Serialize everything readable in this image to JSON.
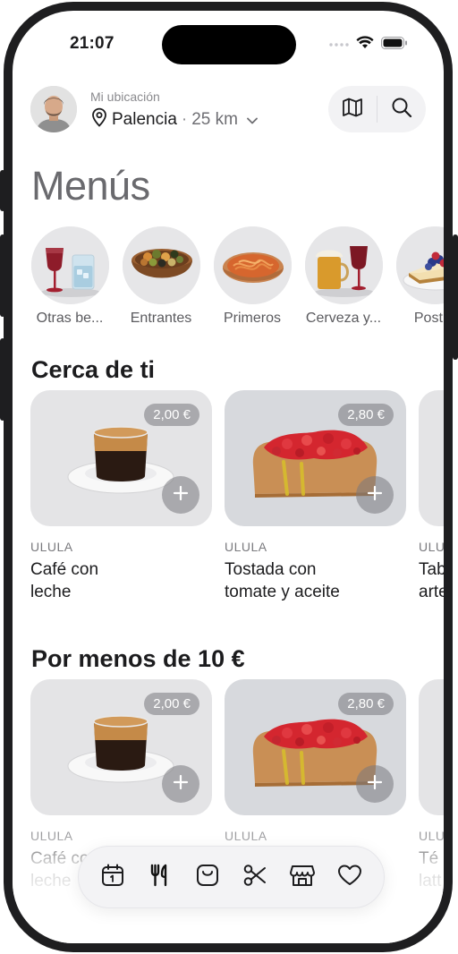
{
  "status": {
    "time": "21:07"
  },
  "header": {
    "caption": "Mi ubicación",
    "city": "Palencia",
    "separator": "·",
    "distance": "25 km"
  },
  "page": {
    "title": "Menús"
  },
  "categories": [
    {
      "label": "Otras be...",
      "icon": "drinks"
    },
    {
      "label": "Entrantes",
      "icon": "olives-bowl"
    },
    {
      "label": "Primeros",
      "icon": "spaghetti"
    },
    {
      "label": "Cerveza y...",
      "icon": "beer-wine"
    },
    {
      "label": "Postre",
      "icon": "cheesecake"
    }
  ],
  "sections": {
    "near": {
      "title": "Cerca de ti",
      "items": [
        {
          "price": "2,00 €",
          "brand": "ULULA",
          "name_line1": "Café con",
          "name_line2": "leche"
        },
        {
          "price": "2,80 €",
          "brand": "ULULA",
          "name_line1": "Tostada con",
          "name_line2": "tomate y aceite"
        },
        {
          "brand": "ULULA",
          "name_line1": "Tab",
          "name_line2": "arte"
        }
      ]
    },
    "cheap": {
      "title": "Por menos de 10 €",
      "items": [
        {
          "price": "2,00 €",
          "brand": "ULULA",
          "name_line1": "Café con",
          "name_line2": "leche"
        },
        {
          "price": "2,80 €",
          "brand": "ULULA",
          "name_line1": "",
          "name_line2": ""
        },
        {
          "brand": "ULUL",
          "name_line1": "Té c",
          "name_line2": "latt"
        }
      ]
    }
  },
  "tabbar": [
    "calendar-icon",
    "cutlery-icon",
    "bag-icon",
    "scissors-icon",
    "store-icon",
    "heart-icon"
  ],
  "colors": {
    "accent": "#1c1c1e",
    "muted": "#8a8a8e",
    "frame": "#1e1e20"
  }
}
